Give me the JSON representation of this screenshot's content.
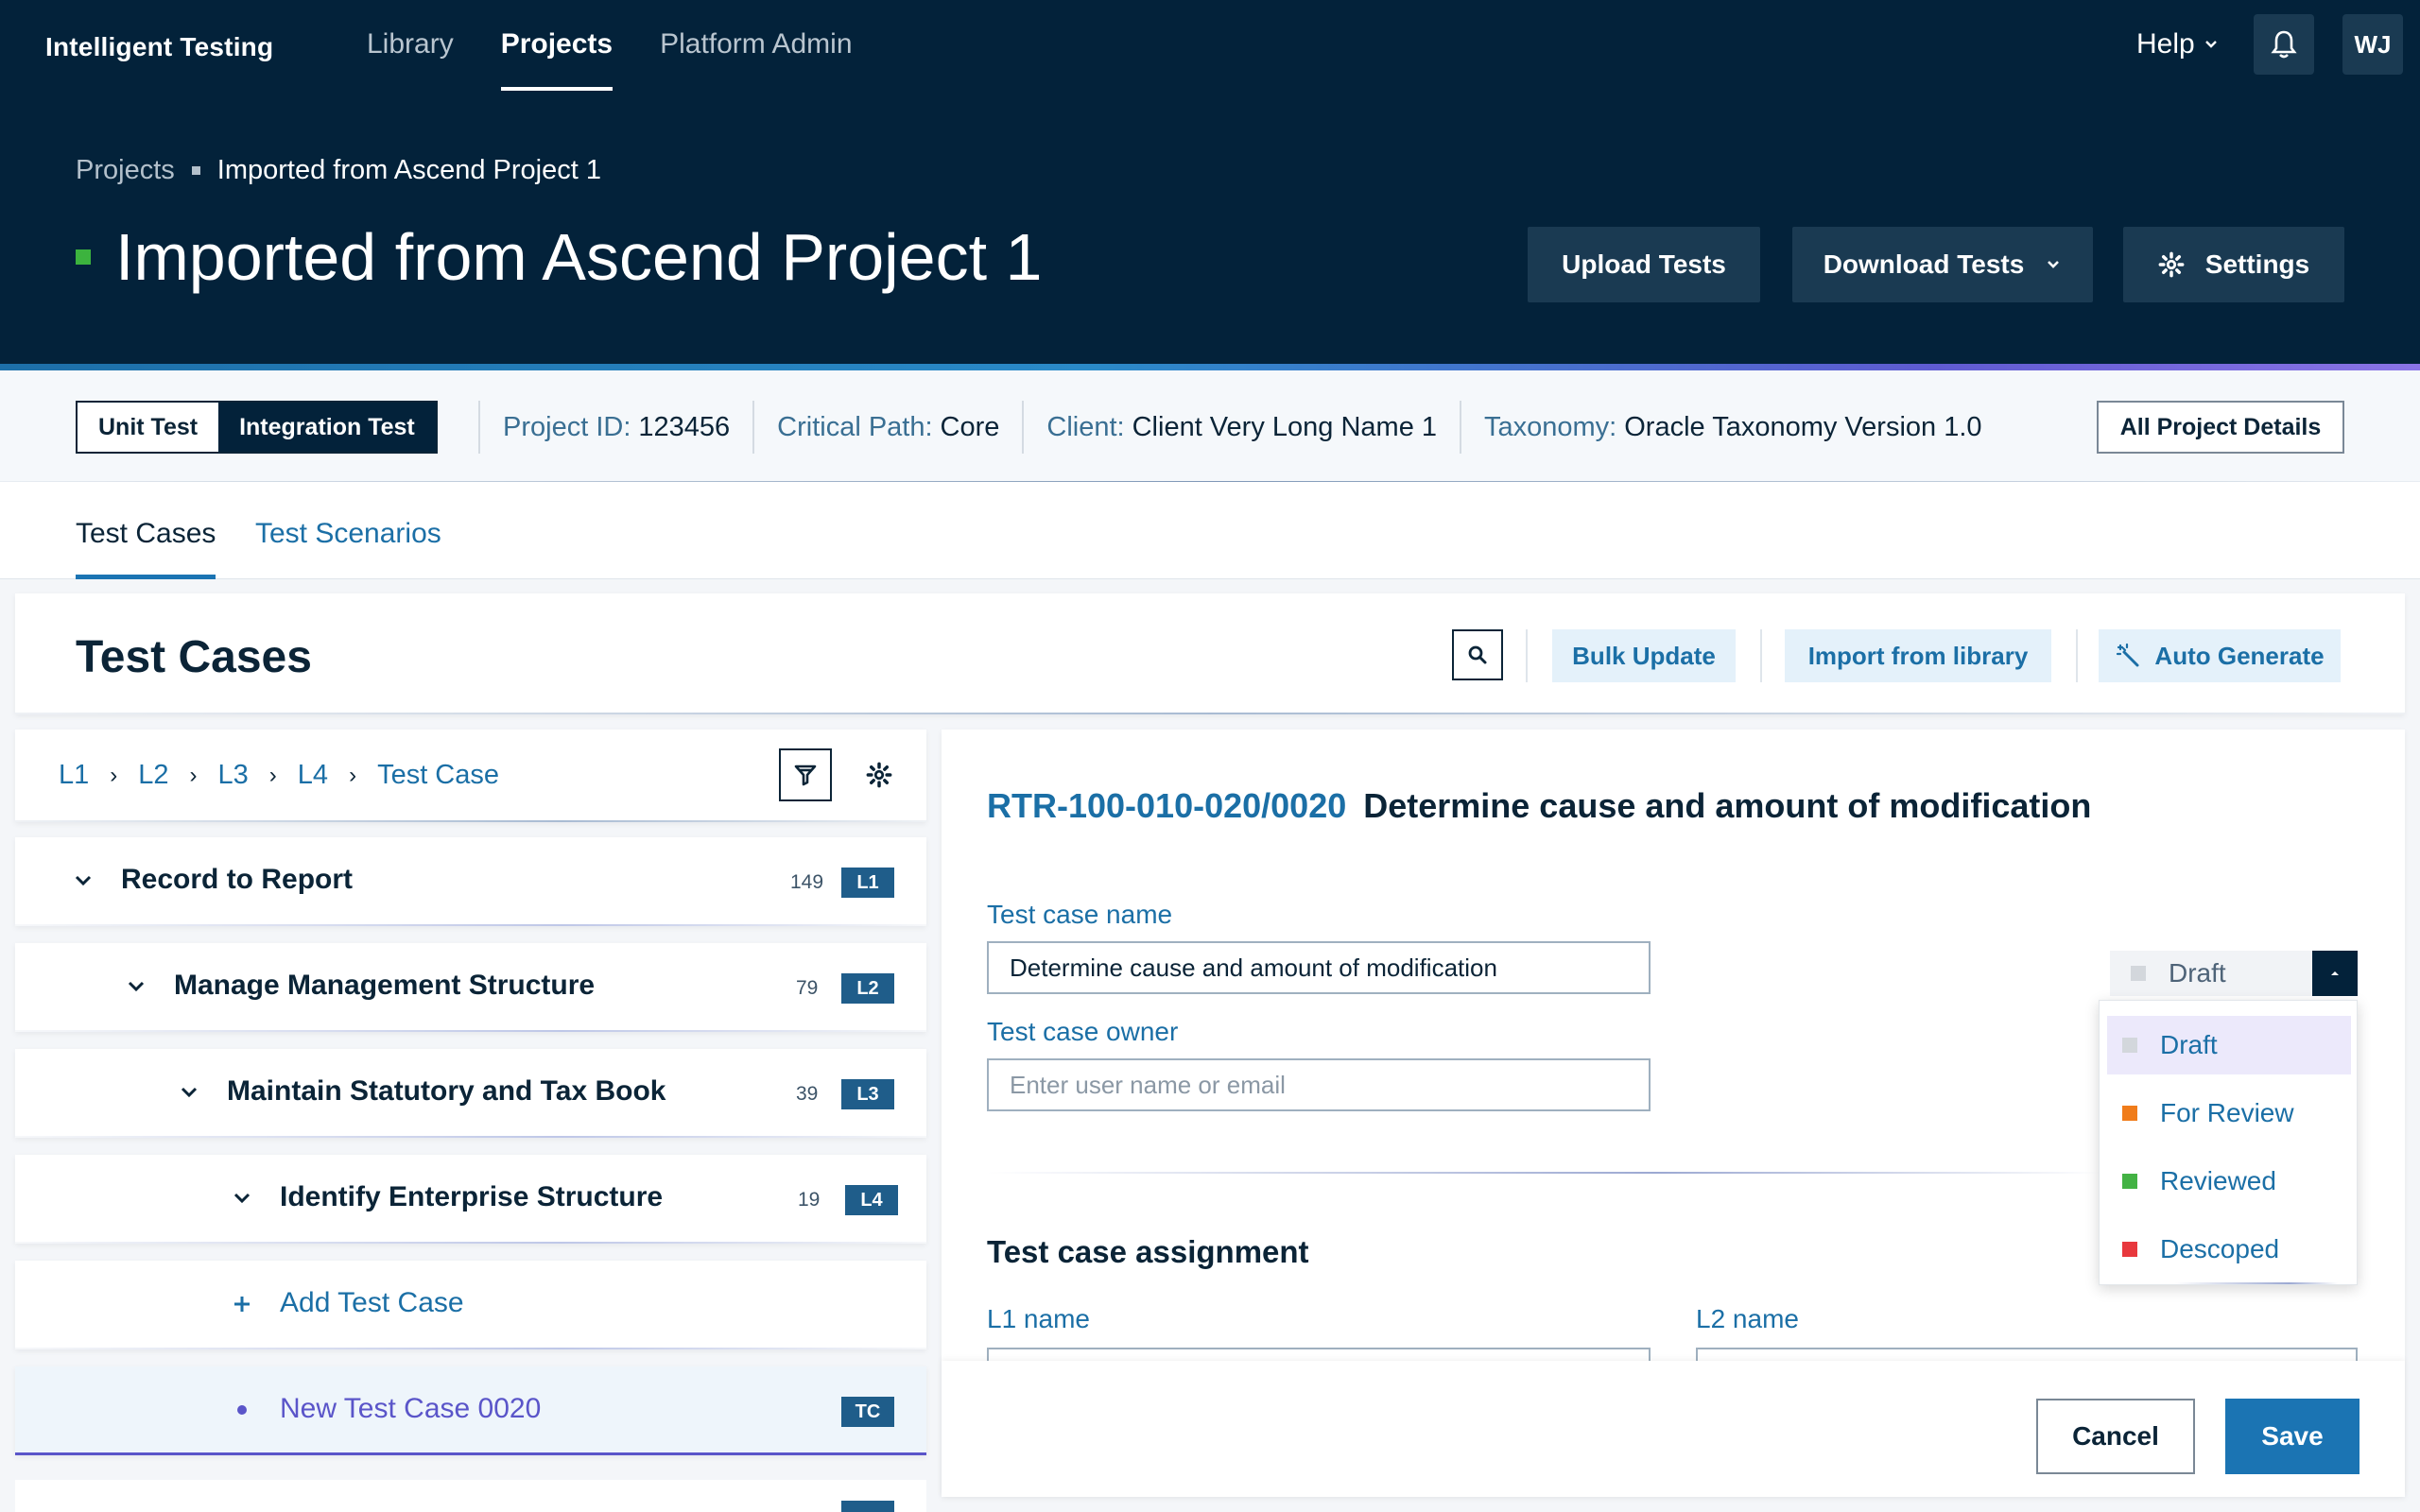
{
  "header": {
    "brand": "Intelligent Testing",
    "nav": [
      {
        "label": "Library"
      },
      {
        "label": "Projects"
      },
      {
        "label": "Platform Admin"
      }
    ],
    "help_label": "Help",
    "avatar_initials": "WJ",
    "breadcrumb": {
      "root": "Projects",
      "current": "Imported from Ascend Project 1"
    },
    "title": "Imported from Ascend Project 1",
    "buttons": {
      "upload": "Upload Tests",
      "download": "Download Tests",
      "settings": "Settings"
    }
  },
  "infobar": {
    "toggle": {
      "unit": "Unit Test",
      "integration": "Integration Test",
      "selected": "Integration Test"
    },
    "items": [
      {
        "label": "Project ID:",
        "value": "123456"
      },
      {
        "label": "Critical Path:",
        "value": "Core"
      },
      {
        "label": "Client:",
        "value": "Client Very Long Name 1"
      },
      {
        "label": "Taxonomy:",
        "value": "Oracle Taxonomy Version 1.0"
      }
    ],
    "all_details": "All Project Details"
  },
  "tabs": [
    {
      "label": "Test Cases",
      "active": true
    },
    {
      "label": "Test Scenarios",
      "active": false
    }
  ],
  "test_cases": {
    "title": "Test Cases",
    "actions": {
      "bulk": "Bulk Update",
      "import": "Import from library",
      "auto": "Auto Generate"
    }
  },
  "tree": {
    "crumbs": [
      "L1",
      "L2",
      "L3",
      "L4",
      "Test Case"
    ],
    "rows": [
      {
        "label": "Record to Report",
        "count": "149",
        "level": "L1"
      },
      {
        "label": "Manage Management Structure",
        "count": "79",
        "level": "L2"
      },
      {
        "label": "Maintain Statutory and Tax Book",
        "count": "39",
        "level": "L3"
      },
      {
        "label": "Identify Enterprise Structure",
        "count": "19",
        "level": "L4"
      }
    ],
    "add_label": "Add Test Case",
    "selected": {
      "label": "New Test Case 0020",
      "level": "TC"
    }
  },
  "detail": {
    "code": "RTR-100-010-020/0020",
    "name": "Determine cause and amount of modification",
    "fields": {
      "name_label": "Test case name",
      "name_value": "Determine cause and amount of modification",
      "owner_label": "Test case owner",
      "owner_placeholder": "Enter user name or email"
    },
    "assignment": {
      "title": "Test case assignment",
      "l1_label": "L1 name",
      "l2_label": "L2 name"
    },
    "status": {
      "selected": "Draft",
      "options": [
        {
          "label": "Draft",
          "color": "#d3d7dc"
        },
        {
          "label": "For Review",
          "color": "#f07c1a"
        },
        {
          "label": "Reviewed",
          "color": "#43b244"
        },
        {
          "label": "Descoped",
          "color": "#e8383d"
        }
      ]
    },
    "footer": {
      "cancel": "Cancel",
      "save": "Save"
    }
  },
  "colors": {
    "header_bg": "#03223a",
    "accent_blue": "#1b74b3",
    "purple": "#5a55c9",
    "title_marker": "#3cb33e"
  }
}
